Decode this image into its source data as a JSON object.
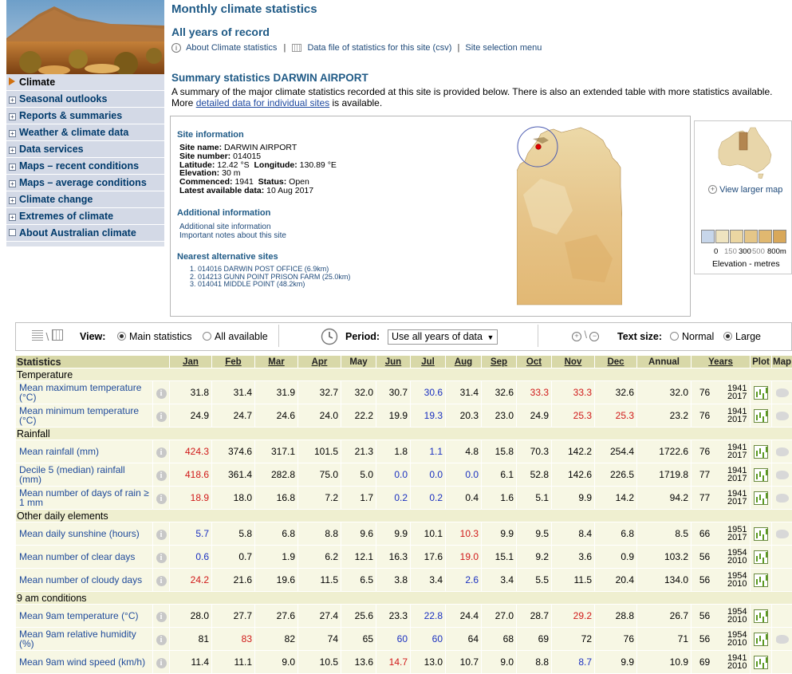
{
  "nav": {
    "items": [
      {
        "label": "Climate",
        "active": true
      },
      {
        "label": "Seasonal outlooks"
      },
      {
        "label": "Reports & summaries"
      },
      {
        "label": "Weather & climate data"
      },
      {
        "label": "Data services"
      },
      {
        "label": "Maps – recent conditions"
      },
      {
        "label": "Maps – average conditions"
      },
      {
        "label": "Climate change"
      },
      {
        "label": "Extremes of climate"
      },
      {
        "label": "About Australian climate"
      }
    ]
  },
  "header": {
    "title": "Monthly climate statistics",
    "subtitle": "All years of record",
    "link_about": "About Climate statistics",
    "link_sep1": "|",
    "link_datafile": "Data file of statistics for this site (csv)",
    "link_sep2": "|",
    "link_selection": "Site selection menu"
  },
  "summary": {
    "heading": "Summary statistics DARWIN AIRPORT",
    "text1": "A summary of the major climate statistics recorded at this site is provided below. There is also an extended table with more statistics available.",
    "text2_pre": "More",
    "text2_link": "detailed data for individual sites",
    "text2_post": "is available."
  },
  "site": {
    "info_heading": "Site information",
    "name_label": "Site name:",
    "name": "DARWIN AIRPORT",
    "number_label": "Site number:",
    "number": "014015",
    "lat_label": "Latitude:",
    "lat": "12.42 °S",
    "lon_label": "Longitude:",
    "lon": "130.89 °E",
    "elev_label": "Elevation:",
    "elev": "30 m",
    "commenced_label": "Commenced:",
    "commenced": "1941",
    "status_label": "Status:",
    "status": "Open",
    "latest_label": "Latest available data:",
    "latest": "10 Aug 2017",
    "additional_heading": "Additional information",
    "additional_link1": "Additional site information",
    "additional_link2": "Important notes about this site",
    "nearest_heading": "Nearest alternative sites",
    "nearest": [
      "1. 014016   DARWIN POST OFFICE (6.9km)",
      "2. 014213   GUNN POINT PRISON FARM (25.0km)",
      "3. 014041   MIDDLE POINT (48.2km)"
    ]
  },
  "map_panel": {
    "view_larger": "View larger map",
    "legend_ticks": [
      "0",
      "150",
      "300",
      "500",
      "800m"
    ],
    "legend_label": "Elevation - metres",
    "legend_colors": [
      "#c7d6ea",
      "#efe4c0",
      "#ebd6a2",
      "#e5c688",
      "#e0b870",
      "#d9a85a"
    ]
  },
  "toolbar": {
    "view_label": "View:",
    "opt_main": "Main statistics",
    "opt_all": "All available",
    "period_label": "Period:",
    "period_value": "Use all years of data",
    "textsize_label": "Text size:",
    "opt_normal": "Normal",
    "opt_large": "Large"
  },
  "table": {
    "headers": [
      "Statistics",
      "Jan",
      "Feb",
      "Mar",
      "Apr",
      "May",
      "Jun",
      "Jul",
      "Aug",
      "Sep",
      "Oct",
      "Nov",
      "Dec",
      "Annual",
      "Years",
      "Plot",
      "Map"
    ],
    "groups": [
      {
        "name": "Temperature",
        "rows": [
          {
            "name": "Mean maximum temperature (°C)",
            "values": [
              "31.8",
              "31.4",
              "31.9",
              "32.7",
              "32.0",
              "30.7",
              "30.6",
              "31.4",
              "32.6",
              "33.3",
              "33.3",
              "32.6"
            ],
            "annual": "32.0",
            "years": "76",
            "range": [
              "1941",
              "2017"
            ],
            "map": true,
            "red": [
              9,
              10
            ],
            "blue": [
              6
            ]
          },
          {
            "name": "Mean minimum temperature (°C)",
            "values": [
              "24.9",
              "24.7",
              "24.6",
              "24.0",
              "22.2",
              "19.9",
              "19.3",
              "20.3",
              "23.0",
              "24.9",
              "25.3",
              "25.3"
            ],
            "annual": "23.2",
            "years": "76",
            "range": [
              "1941",
              "2017"
            ],
            "map": true,
            "red": [
              10,
              11
            ],
            "blue": [
              6
            ]
          }
        ]
      },
      {
        "name": "Rainfall",
        "rows": [
          {
            "name": "Mean rainfall (mm)",
            "values": [
              "424.3",
              "374.6",
              "317.1",
              "101.5",
              "21.3",
              "1.8",
              "1.1",
              "4.8",
              "15.8",
              "70.3",
              "142.2",
              "254.4"
            ],
            "annual": "1722.6",
            "years": "76",
            "range": [
              "1941",
              "2017"
            ],
            "map": true,
            "red": [
              0
            ],
            "blue": [
              6
            ]
          },
          {
            "name": "Decile 5 (median) rainfall (mm)",
            "values": [
              "418.6",
              "361.4",
              "282.8",
              "75.0",
              "5.0",
              "0.0",
              "0.0",
              "0.0",
              "6.1",
              "52.8",
              "142.6",
              "226.5"
            ],
            "annual": "1719.8",
            "years": "77",
            "range": [
              "1941",
              "2017"
            ],
            "map": true,
            "red": [
              0
            ],
            "blue": [
              5,
              6,
              7
            ]
          },
          {
            "name": "Mean number of days of rain ≥ 1 mm",
            "values": [
              "18.9",
              "18.0",
              "16.8",
              "7.2",
              "1.7",
              "0.2",
              "0.2",
              "0.4",
              "1.6",
              "5.1",
              "9.9",
              "14.2"
            ],
            "annual": "94.2",
            "years": "77",
            "range": [
              "1941",
              "2017"
            ],
            "map": true,
            "red": [
              0
            ],
            "blue": [
              5,
              6
            ]
          }
        ]
      },
      {
        "name": "Other daily elements",
        "rows": [
          {
            "name": "Mean daily sunshine (hours)",
            "values": [
              "5.7",
              "5.8",
              "6.8",
              "8.8",
              "9.6",
              "9.9",
              "10.1",
              "10.3",
              "9.9",
              "9.5",
              "8.4",
              "6.8"
            ],
            "annual": "8.5",
            "years": "66",
            "range": [
              "1951",
              "2017"
            ],
            "map": true,
            "red": [
              7
            ],
            "blue": [
              0
            ]
          },
          {
            "name": "Mean number of clear days",
            "values": [
              "0.6",
              "0.7",
              "1.9",
              "6.2",
              "12.1",
              "16.3",
              "17.6",
              "19.0",
              "15.1",
              "9.2",
              "3.6",
              "0.9"
            ],
            "annual": "103.2",
            "years": "56",
            "range": [
              "1954",
              "2010"
            ],
            "map": false,
            "red": [
              7
            ],
            "blue": [
              0
            ]
          },
          {
            "name": "Mean number of cloudy days",
            "values": [
              "24.2",
              "21.6",
              "19.6",
              "11.5",
              "6.5",
              "3.8",
              "3.4",
              "2.6",
              "3.4",
              "5.5",
              "11.5",
              "20.4"
            ],
            "annual": "134.0",
            "years": "56",
            "range": [
              "1954",
              "2010"
            ],
            "map": false,
            "red": [
              0
            ],
            "blue": [
              7
            ]
          }
        ]
      },
      {
        "name": "9 am conditions",
        "rows": [
          {
            "name": "Mean 9am temperature (°C)",
            "values": [
              "28.0",
              "27.7",
              "27.6",
              "27.4",
              "25.6",
              "23.3",
              "22.8",
              "24.4",
              "27.0",
              "28.7",
              "29.2",
              "28.8"
            ],
            "annual": "26.7",
            "years": "56",
            "range": [
              "1954",
              "2010"
            ],
            "map": false,
            "red": [
              10
            ],
            "blue": [
              6
            ]
          },
          {
            "name": "Mean 9am relative humidity (%)",
            "values": [
              "81",
              "83",
              "82",
              "74",
              "65",
              "60",
              "60",
              "64",
              "68",
              "69",
              "72",
              "76"
            ],
            "annual": "71",
            "years": "56",
            "range": [
              "1954",
              "2010"
            ],
            "map": true,
            "red": [
              1
            ],
            "blue": [
              5,
              6
            ]
          },
          {
            "name": "Mean 9am wind speed (km/h)",
            "values": [
              "11.4",
              "11.1",
              "9.0",
              "10.5",
              "13.6",
              "14.7",
              "13.0",
              "10.7",
              "9.0",
              "8.8",
              "8.7",
              "9.9"
            ],
            "annual": "10.9",
            "years": "69",
            "range": [
              "1941",
              "2010"
            ],
            "map": false,
            "red": [
              5
            ],
            "blue": [
              10
            ]
          }
        ]
      }
    ]
  }
}
